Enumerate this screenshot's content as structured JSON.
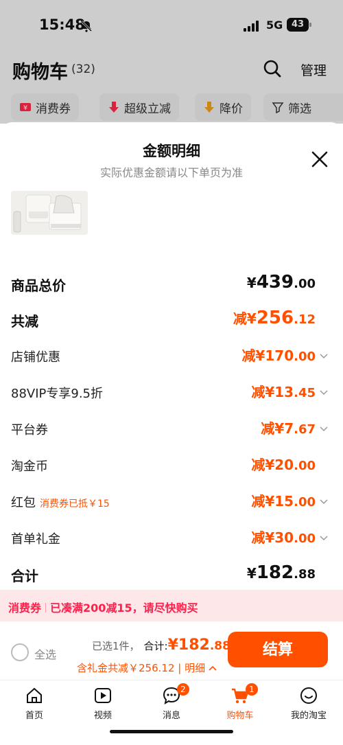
{
  "status": {
    "time": "15:48",
    "network": "5G",
    "battery": "43"
  },
  "header": {
    "title": "购物车",
    "count": "(32)",
    "manage": "管理"
  },
  "filters": [
    {
      "label": "消费券"
    },
    {
      "label": "超级立减"
    },
    {
      "label": "降价"
    },
    {
      "label": "筛选"
    }
  ],
  "sheet": {
    "title": "金额明细",
    "subtitle": "实际优惠金额请以下单页为准"
  },
  "rows": {
    "total": {
      "label": "商品总价",
      "currency": "¥",
      "int": "439",
      "dec": ".00"
    },
    "reduce": {
      "label": "共减",
      "prefix": "减¥",
      "int": "256",
      "dec": ".12"
    },
    "store": {
      "label": "店铺优惠",
      "prefix": "减¥",
      "int": "170",
      "dec": ".00"
    },
    "vip": {
      "label": "88VIP专享9.5折",
      "prefix": "减¥",
      "int": "13",
      "dec": ".45"
    },
    "platform": {
      "label": "平台券",
      "prefix": "减¥",
      "int": "7",
      "dec": ".67"
    },
    "coin": {
      "label": "淘金币",
      "prefix": "减¥",
      "int": "20",
      "dec": ".00"
    },
    "redpack": {
      "label": "红包",
      "note": "消费券已抵￥15",
      "prefix": "减¥",
      "int": "15",
      "dec": ".00"
    },
    "firstorder": {
      "label": "首单礼金",
      "prefix": "减¥",
      "int": "30",
      "dec": ".00"
    },
    "sum": {
      "label": "合计",
      "currency": "¥",
      "int": "182",
      "dec": ".88"
    }
  },
  "promo": {
    "tag": "消费券",
    "text": "已凑满200减15，请尽快购买"
  },
  "checkout": {
    "select_all": "全选",
    "selected": "已选1件，",
    "total_label": "合计:",
    "total_int": "¥182",
    "total_dec": ".88",
    "discount": "含礼金共减￥256.12 | 明细",
    "pay": "结算"
  },
  "tabs": [
    {
      "label": "首页"
    },
    {
      "label": "视频"
    },
    {
      "label": "消息",
      "badge": "2"
    },
    {
      "label": "购物车",
      "badge": "1"
    },
    {
      "label": "我的淘宝"
    }
  ],
  "colors": {
    "accent": "#ff5000",
    "promo_bg": "#fde7e8",
    "promo_text": "#ff1f4b"
  }
}
